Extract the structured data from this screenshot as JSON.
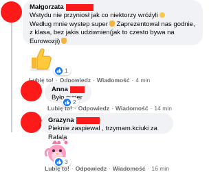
{
  "comments": [
    {
      "author": "Małgorzata",
      "lines": [
        "Wstydu nie przyniosł jak co niektorzy wróżyli",
        "Według mnie wystep super",
        " Zaprezentowal nas godnie,",
        "z klasa, bez jakis udziwnien(jak to czesto bywa na",
        "Eurowozji)"
      ],
      "reaction_count": "1",
      "actions": {
        "like": "Lubię to!",
        "reply": "Odpowiedz",
        "message": "Wiadomość",
        "time": "4 min"
      }
    },
    {
      "author": "Anna",
      "text": "Było super",
      "reaction_count": "2",
      "actions": {
        "like": "Lubię to!",
        "reply": "Odpowiedz",
        "message": "Wiadomość",
        "time": "14 min"
      }
    },
    {
      "author": "Grazyna",
      "text": "Pieknie zaspiewal , trzymam.kciuki za Rafala",
      "reaction_count": "3",
      "actions": {
        "like": "Lubię to!",
        "reply": "Odpowiedz",
        "message": "Wiadomość",
        "time": "16 min"
      }
    }
  ],
  "icons": {
    "like_icon": "thumbs-up",
    "sticker": "pink-bird"
  },
  "colors": {
    "redaction": "#ff1a1a",
    "like_blue": "#1877f2",
    "bubble": "#f0f2f5",
    "meta": "#65676b"
  }
}
